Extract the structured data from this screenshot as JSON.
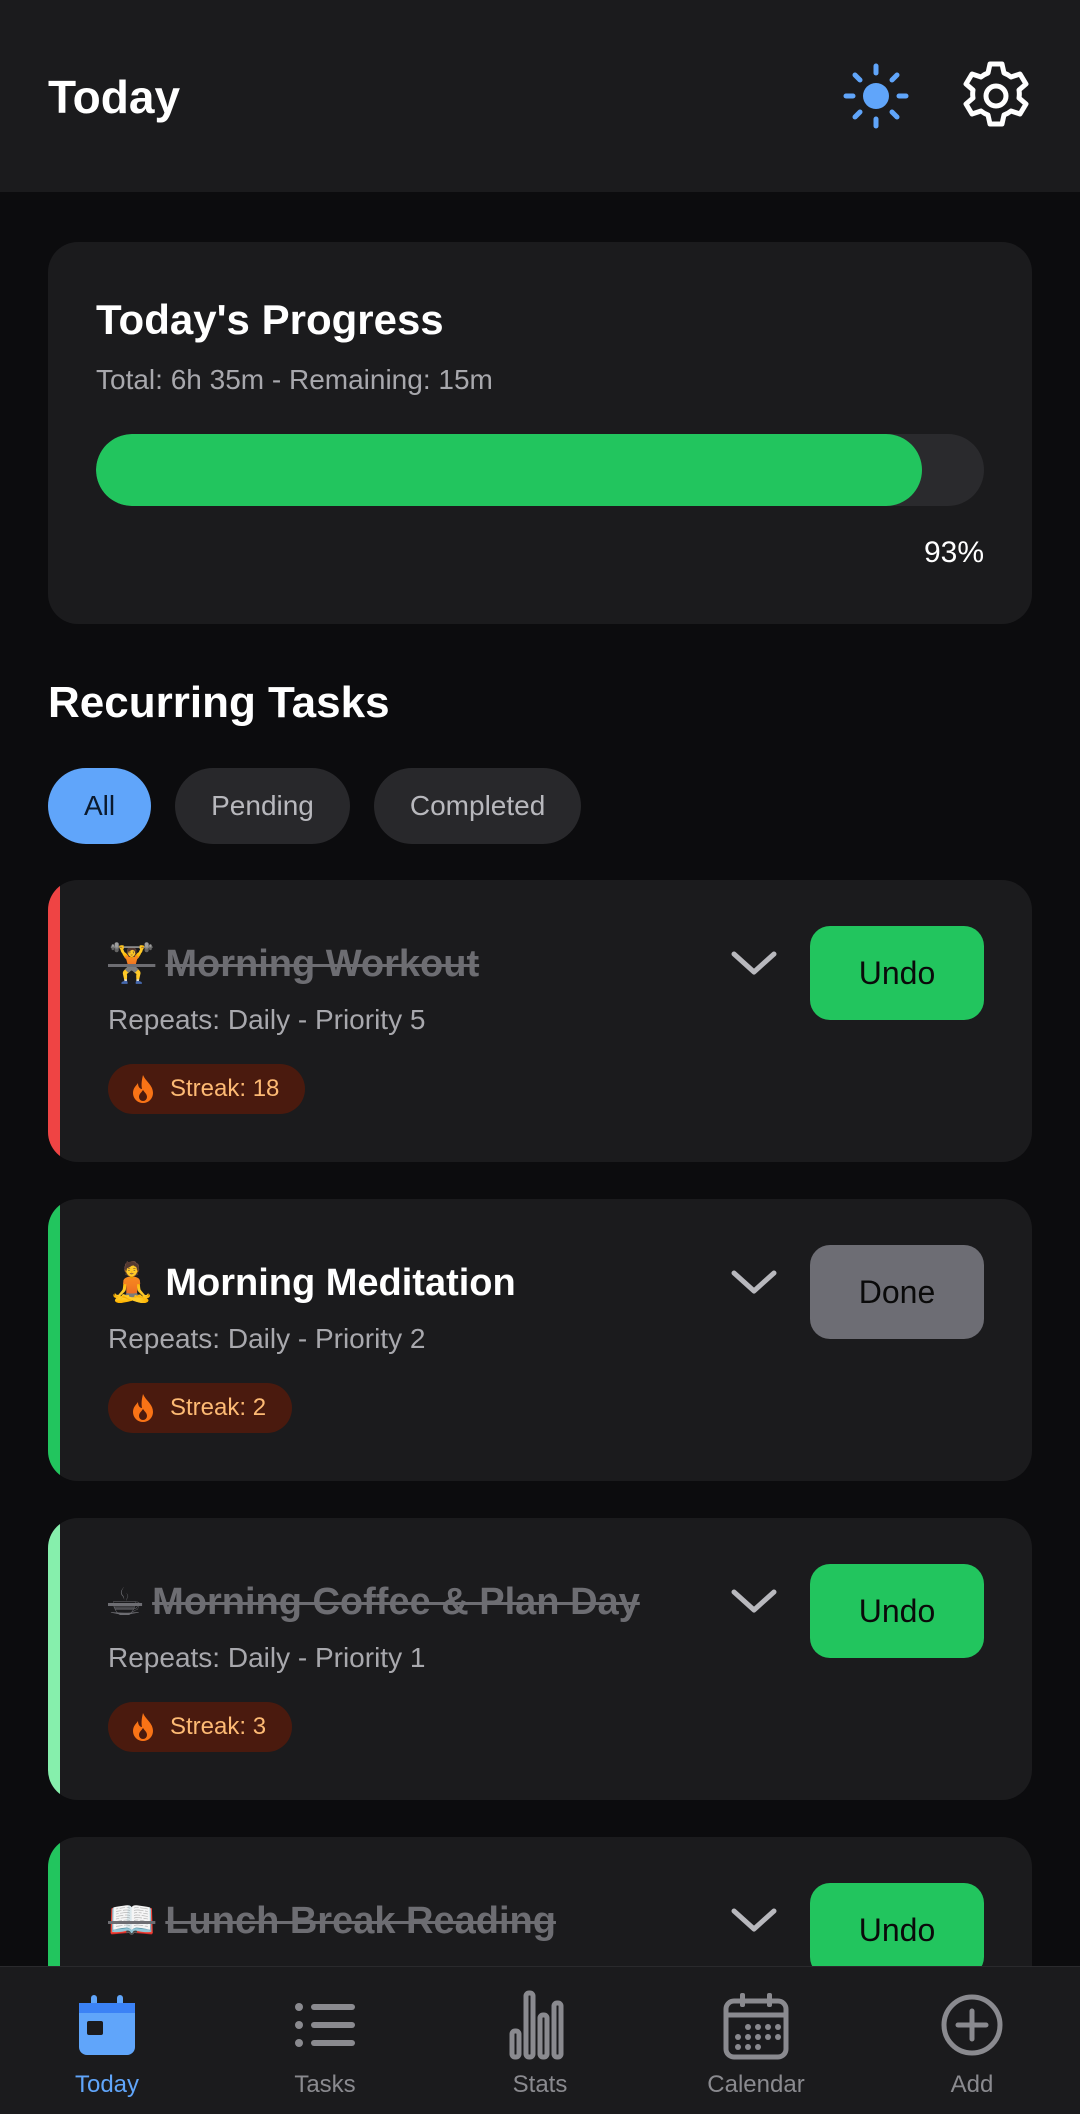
{
  "header": {
    "title": "Today",
    "theme_icon": "sun-icon",
    "settings_icon": "gear-icon"
  },
  "progress": {
    "title": "Today's Progress",
    "subtitle": "Total: 6h 35m - Remaining: 15m",
    "percent_label": "93%",
    "percent_value": 93
  },
  "section": {
    "title": "Recurring Tasks"
  },
  "filters": [
    "All",
    "Pending",
    "Completed"
  ],
  "tasks": [
    {
      "emoji": "🏋",
      "name": "Morning Workout",
      "meta": "Repeats: Daily - Priority 5",
      "streak": "Streak: 18",
      "action": "Undo",
      "completed": true,
      "accent": "#ef4444"
    },
    {
      "emoji": "🧘",
      "name": "Morning Meditation",
      "meta": "Repeats: Daily - Priority 2",
      "streak": "Streak: 2",
      "action": "Done",
      "completed": false,
      "accent": "#22c55e"
    },
    {
      "emoji": "☕",
      "name": "Morning Coffee & Plan Day",
      "meta": "Repeats: Daily - Priority 1",
      "streak": "Streak: 3",
      "action": "Undo",
      "completed": true,
      "accent": "#86efac"
    },
    {
      "emoji": "📖",
      "name": "Lunch Break Reading",
      "meta": "",
      "streak": "",
      "action": "Undo",
      "completed": true,
      "accent": "#22c55e"
    }
  ],
  "nav": {
    "items": [
      {
        "label": "Today",
        "icon": "calendar-today-icon",
        "active": true
      },
      {
        "label": "Tasks",
        "icon": "list-icon",
        "active": false
      },
      {
        "label": "Stats",
        "icon": "bar-chart-icon",
        "active": false
      },
      {
        "label": "Calendar",
        "icon": "calendar-grid-icon",
        "active": false
      },
      {
        "label": "Add",
        "icon": "plus-circle-icon",
        "active": false
      }
    ]
  },
  "colors": {
    "accent": "#60a5fa",
    "success": "#22c55e",
    "background": "#0c0c0e",
    "card": "#1b1b1d"
  }
}
